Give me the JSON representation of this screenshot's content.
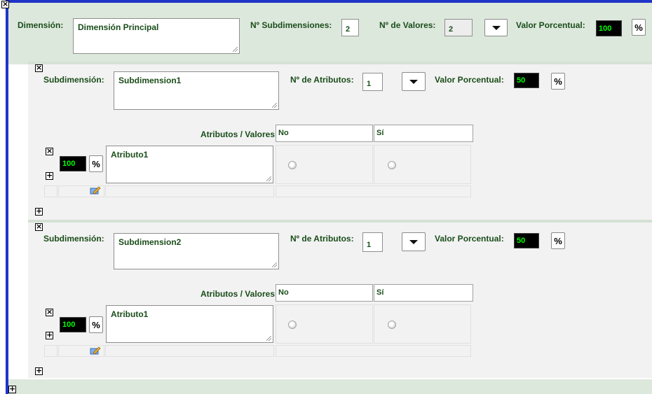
{
  "dimension": {
    "label": "Dimensión:",
    "name": "Dimensión Principal",
    "subdims_label": "Nº Subdimensiones:",
    "subdims_value": "2",
    "values_label": "Nº de Valores:",
    "values_value": "2",
    "pct_label": "Valor Porcentual:",
    "pct_value": "100",
    "pct_button": "%"
  },
  "subdimensions": [
    {
      "label": "Subdimensión:",
      "name": "Subdimension1",
      "attrs_label": "Nº de Atributos:",
      "attrs_value": "1",
      "pct_label": "Valor Porcentual:",
      "pct_value": "50",
      "pct_button": "%",
      "table_header": "Atributos / Valores",
      "columns": [
        "No",
        "Sí"
      ],
      "attribute": {
        "pct_value": "100",
        "pct_button": "%",
        "name": "Atributo1"
      }
    },
    {
      "label": "Subdimensión:",
      "name": "Subdimension2",
      "attrs_label": "Nº de Atributos:",
      "attrs_value": "1",
      "pct_label": "Valor Porcentual:",
      "pct_value": "50",
      "pct_button": "%",
      "table_header": "Atributos / Valores",
      "columns": [
        "No",
        "Sí"
      ],
      "attribute": {
        "pct_value": "100",
        "pct_button": "%",
        "name": "Atributo1"
      }
    }
  ],
  "icons": {
    "close": "close-icon",
    "add": "plus-icon",
    "dropdown": "chevron-down-icon",
    "edit": "edit-icon"
  },
  "symbols": {
    "close": "×",
    "add": "+"
  },
  "colors": {
    "frame_border": "#1f35c8",
    "dimension_bg": "#dde8dd",
    "subdimension_bg": "#f2f2f2",
    "label_text": "#1a4d1a",
    "pct_box_bg": "#000000",
    "pct_box_text": "#00ff00"
  }
}
